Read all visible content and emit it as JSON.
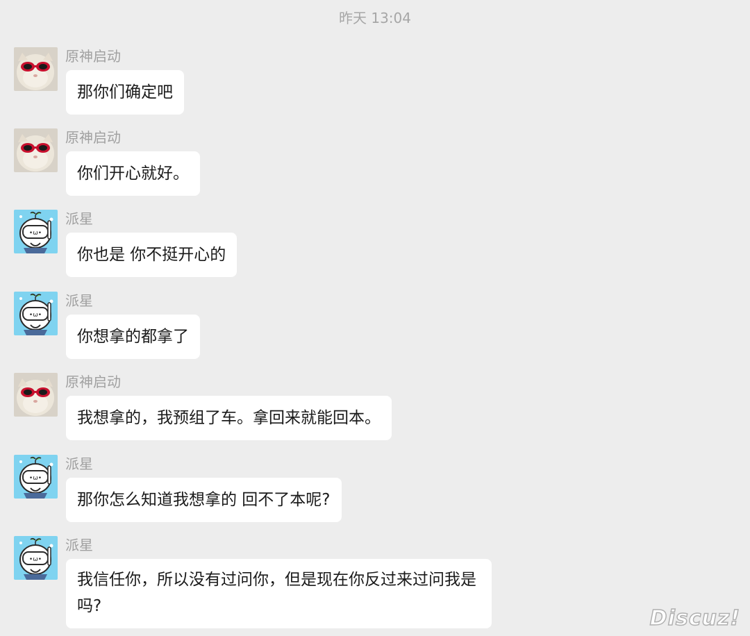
{
  "timestamp": "昨天 13:04",
  "messages": [
    {
      "sender": "原神启动",
      "avatar": "cat-sunglasses-avatar",
      "text": "那你们确定吧"
    },
    {
      "sender": "原神启动",
      "avatar": "cat-sunglasses-avatar",
      "text": "你们开心就好。"
    },
    {
      "sender": "派星",
      "avatar": "cartoon-diver-avatar",
      "text": "你也是 你不挺开心的"
    },
    {
      "sender": "派星",
      "avatar": "cartoon-diver-avatar",
      "text": "你想拿的都拿了"
    },
    {
      "sender": "原神启动",
      "avatar": "cat-sunglasses-avatar",
      "text": "我想拿的，我预组了车。拿回来就能回本。"
    },
    {
      "sender": "派星",
      "avatar": "cartoon-diver-avatar",
      "text": "那你怎么知道我想拿的 回不了本呢?"
    },
    {
      "sender": "派星",
      "avatar": "cartoon-diver-avatar",
      "text": "我信任你，所以没有过问你，但是现在你反过来过问我是吗?"
    }
  ],
  "watermark": "Discuz!",
  "colors": {
    "background": "#ededed",
    "bubble": "#ffffff",
    "meta_text": "#a0a0a0"
  }
}
